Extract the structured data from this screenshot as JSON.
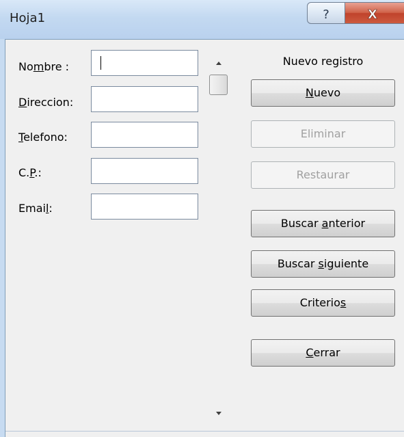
{
  "window": {
    "title": "Hoja1",
    "help_glyph": "?",
    "close_glyph": "X"
  },
  "form": {
    "fields": [
      {
        "label_pre": "No",
        "label_acc": "m",
        "label_post": "bre :",
        "value": ""
      },
      {
        "label_pre": "",
        "label_acc": "D",
        "label_post": "ireccion:",
        "value": ""
      },
      {
        "label_pre": "",
        "label_acc": "T",
        "label_post": "elefono:",
        "value": ""
      },
      {
        "label_pre": "C.",
        "label_acc": "P",
        "label_post": ".:",
        "value": ""
      },
      {
        "label_pre": "Emai",
        "label_acc": "l",
        "label_post": ":",
        "value": ""
      }
    ]
  },
  "record": {
    "title": "Nuevo registro"
  },
  "buttons": {
    "nuevo": {
      "pre": "",
      "acc": "N",
      "post": "uevo"
    },
    "eliminar": {
      "label": "Eliminar"
    },
    "restaurar": {
      "label": "Restaurar"
    },
    "buscar_anterior": {
      "pre": "Buscar ",
      "acc": "a",
      "post": "nterior"
    },
    "buscar_siguiente": {
      "pre": "Buscar ",
      "acc": "s",
      "post": "iguiente"
    },
    "criterios": {
      "pre": "Criterio",
      "acc": "s",
      "post": ""
    },
    "cerrar": {
      "pre": "",
      "acc": "C",
      "post": "errar"
    }
  },
  "icons": {
    "help": "question-mark-icon",
    "close": "close-x-icon",
    "scroll_up": "triangle-up-icon",
    "scroll_down": "triangle-down-icon"
  },
  "colors": {
    "titlebar": "#c3d9f1",
    "close_button": "#c9503a",
    "dialog_background": "#f0f0f0"
  }
}
